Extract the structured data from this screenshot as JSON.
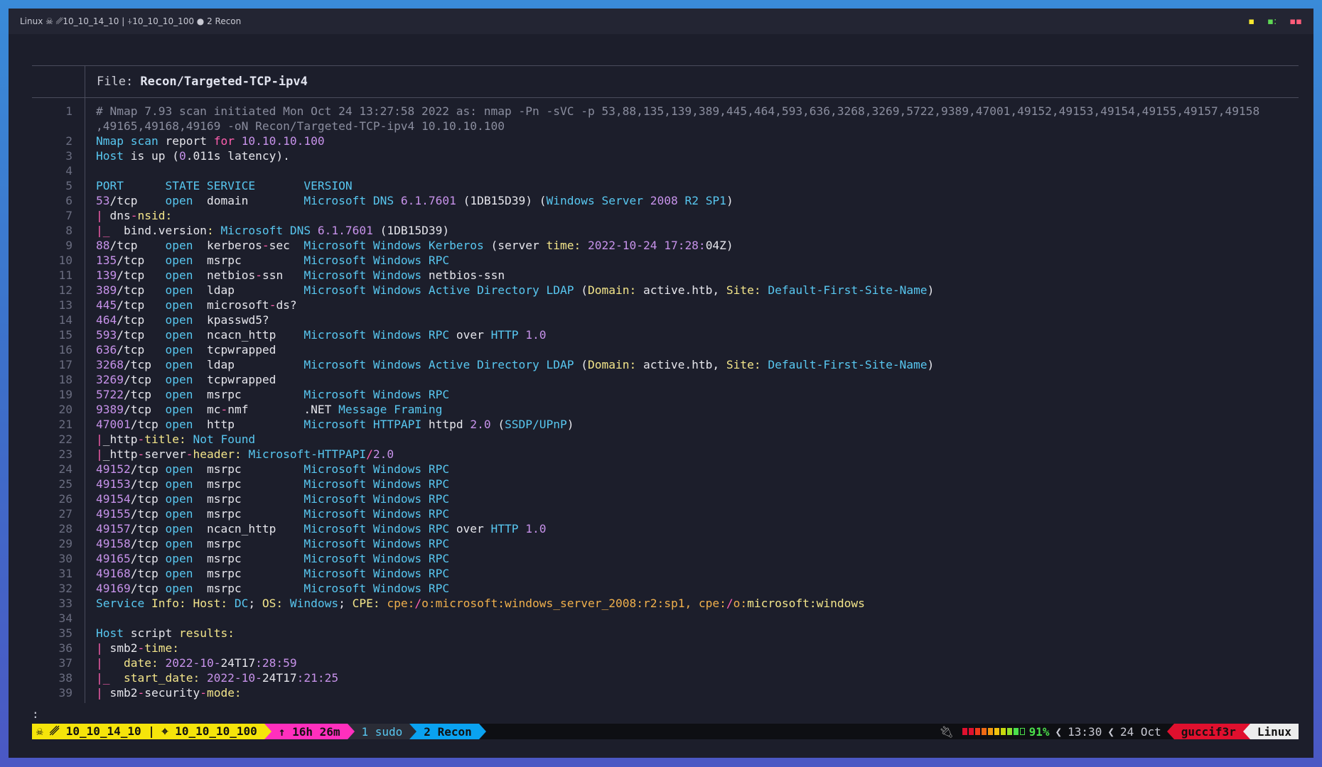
{
  "window": {
    "title": "Linux ☠ ␥10_10_14_10 | ⍭10_10_10_100 ● 2 Recon"
  },
  "pager": {
    "file_label": "File: ",
    "file_name": "Recon/Targeted-TCP-ipv4",
    "prompt": ":"
  },
  "lines": [
    {
      "n": "1",
      "segs": [
        [
          "c-cm",
          "# Nmap 7.93 scan initiated Mon Oct 24 13:27:58 2022 as: nmap -Pn -sVC -p 53,88,135,139,389,445,464,593,636,3268,3269,5722,9389,47001,49152,49153,49154,49155,49157,49158"
        ]
      ]
    },
    {
      "n": "",
      "segs": [
        [
          "c-cm",
          ",49165,49168,49169 -oN Recon/Targeted-TCP-ipv4 10.10.10.100"
        ]
      ]
    },
    {
      "n": "2",
      "segs": [
        [
          "c-cy",
          "Nmap scan "
        ],
        [
          "c-wh",
          "report "
        ],
        [
          "c-pk",
          "for "
        ],
        [
          "c-pu",
          "10.10.10.100"
        ]
      ]
    },
    {
      "n": "3",
      "segs": [
        [
          "c-cy",
          "Host "
        ],
        [
          "c-wh",
          "is up ("
        ],
        [
          "c-pu",
          "0"
        ],
        [
          "c-wh",
          ".011s latency)."
        ]
      ]
    },
    {
      "n": "4",
      "segs": [
        [
          "c-wh",
          ""
        ]
      ]
    },
    {
      "n": "5",
      "segs": [
        [
          "c-cy",
          "PORT      STATE SERVICE       VERSION"
        ]
      ]
    },
    {
      "n": "6",
      "segs": [
        [
          "c-pu",
          "53"
        ],
        [
          "c-wh",
          "/tcp    "
        ],
        [
          "c-cy",
          "open  "
        ],
        [
          "c-wh",
          "domain        "
        ],
        [
          "c-cy",
          "Microsoft DNS "
        ],
        [
          "c-pu",
          "6.1.7601 "
        ],
        [
          "c-wh",
          "(1DB15D39) ("
        ],
        [
          "c-cy",
          "Windows Server "
        ],
        [
          "c-pu",
          "2008 "
        ],
        [
          "c-cy",
          "R2 SP1"
        ],
        [
          "c-wh",
          ")"
        ]
      ]
    },
    {
      "n": "7",
      "segs": [
        [
          "c-pk",
          "| "
        ],
        [
          "c-wh",
          "dns"
        ],
        [
          "c-pk",
          "-"
        ],
        [
          "c-ye",
          "nsid:"
        ]
      ]
    },
    {
      "n": "8",
      "segs": [
        [
          "c-pk",
          "|_  "
        ],
        [
          "c-wh",
          "bind.version"
        ],
        [
          "c-ye",
          ": "
        ],
        [
          "c-cy",
          "Microsoft DNS "
        ],
        [
          "c-pu",
          "6.1.7601 "
        ],
        [
          "c-wh",
          "(1DB15D39)"
        ]
      ]
    },
    {
      "n": "9",
      "segs": [
        [
          "c-pu",
          "88"
        ],
        [
          "c-wh",
          "/tcp    "
        ],
        [
          "c-cy",
          "open  "
        ],
        [
          "c-wh",
          "kerberos"
        ],
        [
          "c-pk",
          "-"
        ],
        [
          "c-wh",
          "sec  "
        ],
        [
          "c-cy",
          "Microsoft Windows Kerberos "
        ],
        [
          "c-wh",
          "(server "
        ],
        [
          "c-ye",
          "time: "
        ],
        [
          "c-pu",
          "2022-10-24 17:28:"
        ],
        [
          "c-wh",
          "04Z)"
        ]
      ]
    },
    {
      "n": "10",
      "segs": [
        [
          "c-pu",
          "135"
        ],
        [
          "c-wh",
          "/tcp   "
        ],
        [
          "c-cy",
          "open  "
        ],
        [
          "c-wh",
          "msrpc         "
        ],
        [
          "c-cy",
          "Microsoft Windows RPC"
        ]
      ]
    },
    {
      "n": "11",
      "segs": [
        [
          "c-pu",
          "139"
        ],
        [
          "c-wh",
          "/tcp   "
        ],
        [
          "c-cy",
          "open  "
        ],
        [
          "c-wh",
          "netbios"
        ],
        [
          "c-pk",
          "-"
        ],
        [
          "c-wh",
          "ssn   "
        ],
        [
          "c-cy",
          "Microsoft Windows "
        ],
        [
          "c-wh",
          "netbios-ssn"
        ]
      ]
    },
    {
      "n": "12",
      "segs": [
        [
          "c-pu",
          "389"
        ],
        [
          "c-wh",
          "/tcp   "
        ],
        [
          "c-cy",
          "open  "
        ],
        [
          "c-wh",
          "ldap          "
        ],
        [
          "c-cy",
          "Microsoft Windows Active Directory LDAP "
        ],
        [
          "c-wh",
          "("
        ],
        [
          "c-ye",
          "Domain: "
        ],
        [
          "c-wh",
          "active.htb, "
        ],
        [
          "c-ye",
          "Site: "
        ],
        [
          "c-cy",
          "Default-First-Site-Name"
        ],
        [
          "c-wh",
          ")"
        ]
      ]
    },
    {
      "n": "13",
      "segs": [
        [
          "c-pu",
          "445"
        ],
        [
          "c-wh",
          "/tcp   "
        ],
        [
          "c-cy",
          "open  "
        ],
        [
          "c-wh",
          "microsoft"
        ],
        [
          "c-pk",
          "-"
        ],
        [
          "c-wh",
          "ds?"
        ]
      ]
    },
    {
      "n": "14",
      "segs": [
        [
          "c-pu",
          "464"
        ],
        [
          "c-wh",
          "/tcp   "
        ],
        [
          "c-cy",
          "open  "
        ],
        [
          "c-wh",
          "kpasswd5?"
        ]
      ]
    },
    {
      "n": "15",
      "segs": [
        [
          "c-pu",
          "593"
        ],
        [
          "c-wh",
          "/tcp   "
        ],
        [
          "c-cy",
          "open  "
        ],
        [
          "c-wh",
          "ncacn_http    "
        ],
        [
          "c-cy",
          "Microsoft Windows RPC "
        ],
        [
          "c-wh",
          "over "
        ],
        [
          "c-cy",
          "HTTP "
        ],
        [
          "c-pu",
          "1.0"
        ]
      ]
    },
    {
      "n": "16",
      "segs": [
        [
          "c-pu",
          "636"
        ],
        [
          "c-wh",
          "/tcp   "
        ],
        [
          "c-cy",
          "open  "
        ],
        [
          "c-wh",
          "tcpwrapped"
        ]
      ]
    },
    {
      "n": "17",
      "segs": [
        [
          "c-pu",
          "3268"
        ],
        [
          "c-wh",
          "/tcp  "
        ],
        [
          "c-cy",
          "open  "
        ],
        [
          "c-wh",
          "ldap          "
        ],
        [
          "c-cy",
          "Microsoft Windows Active Directory LDAP "
        ],
        [
          "c-wh",
          "("
        ],
        [
          "c-ye",
          "Domain: "
        ],
        [
          "c-wh",
          "active.htb, "
        ],
        [
          "c-ye",
          "Site: "
        ],
        [
          "c-cy",
          "Default-First-Site-Name"
        ],
        [
          "c-wh",
          ")"
        ]
      ]
    },
    {
      "n": "18",
      "segs": [
        [
          "c-pu",
          "3269"
        ],
        [
          "c-wh",
          "/tcp  "
        ],
        [
          "c-cy",
          "open  "
        ],
        [
          "c-wh",
          "tcpwrapped"
        ]
      ]
    },
    {
      "n": "19",
      "segs": [
        [
          "c-pu",
          "5722"
        ],
        [
          "c-wh",
          "/tcp  "
        ],
        [
          "c-cy",
          "open  "
        ],
        [
          "c-wh",
          "msrpc         "
        ],
        [
          "c-cy",
          "Microsoft Windows RPC"
        ]
      ]
    },
    {
      "n": "20",
      "segs": [
        [
          "c-pu",
          "9389"
        ],
        [
          "c-wh",
          "/tcp  "
        ],
        [
          "c-cy",
          "open  "
        ],
        [
          "c-wh",
          "mc"
        ],
        [
          "c-pk",
          "-"
        ],
        [
          "c-wh",
          "nmf        .NET "
        ],
        [
          "c-cy",
          "Message Framing"
        ]
      ]
    },
    {
      "n": "21",
      "segs": [
        [
          "c-pu",
          "47001"
        ],
        [
          "c-wh",
          "/tcp "
        ],
        [
          "c-cy",
          "open  "
        ],
        [
          "c-wh",
          "http          "
        ],
        [
          "c-cy",
          "Microsoft HTTPAPI "
        ],
        [
          "c-wh",
          "httpd "
        ],
        [
          "c-pu",
          "2.0 "
        ],
        [
          "c-wh",
          "("
        ],
        [
          "c-cy",
          "SSDP/UPnP"
        ],
        [
          "c-wh",
          ")"
        ]
      ]
    },
    {
      "n": "22",
      "segs": [
        [
          "c-pk",
          "|"
        ],
        [
          "c-wh",
          "_http"
        ],
        [
          "c-pk",
          "-"
        ],
        [
          "c-ye",
          "title: "
        ],
        [
          "c-cy",
          "Not Found"
        ]
      ]
    },
    {
      "n": "23",
      "segs": [
        [
          "c-pk",
          "|"
        ],
        [
          "c-wh",
          "_http"
        ],
        [
          "c-pk",
          "-"
        ],
        [
          "c-wh",
          "server"
        ],
        [
          "c-pk",
          "-"
        ],
        [
          "c-ye",
          "header: "
        ],
        [
          "c-cy",
          "Microsoft-HTTPAPI"
        ],
        [
          "c-pk",
          "/"
        ],
        [
          "c-pu",
          "2.0"
        ]
      ]
    },
    {
      "n": "24",
      "segs": [
        [
          "c-pu",
          "49152"
        ],
        [
          "c-wh",
          "/tcp "
        ],
        [
          "c-cy",
          "open  "
        ],
        [
          "c-wh",
          "msrpc         "
        ],
        [
          "c-cy",
          "Microsoft Windows RPC"
        ]
      ]
    },
    {
      "n": "25",
      "segs": [
        [
          "c-pu",
          "49153"
        ],
        [
          "c-wh",
          "/tcp "
        ],
        [
          "c-cy",
          "open  "
        ],
        [
          "c-wh",
          "msrpc         "
        ],
        [
          "c-cy",
          "Microsoft Windows RPC"
        ]
      ]
    },
    {
      "n": "26",
      "segs": [
        [
          "c-pu",
          "49154"
        ],
        [
          "c-wh",
          "/tcp "
        ],
        [
          "c-cy",
          "open  "
        ],
        [
          "c-wh",
          "msrpc         "
        ],
        [
          "c-cy",
          "Microsoft Windows RPC"
        ]
      ]
    },
    {
      "n": "27",
      "segs": [
        [
          "c-pu",
          "49155"
        ],
        [
          "c-wh",
          "/tcp "
        ],
        [
          "c-cy",
          "open  "
        ],
        [
          "c-wh",
          "msrpc         "
        ],
        [
          "c-cy",
          "Microsoft Windows RPC"
        ]
      ]
    },
    {
      "n": "28",
      "segs": [
        [
          "c-pu",
          "49157"
        ],
        [
          "c-wh",
          "/tcp "
        ],
        [
          "c-cy",
          "open  "
        ],
        [
          "c-wh",
          "ncacn_http    "
        ],
        [
          "c-cy",
          "Microsoft Windows RPC "
        ],
        [
          "c-wh",
          "over "
        ],
        [
          "c-cy",
          "HTTP "
        ],
        [
          "c-pu",
          "1.0"
        ]
      ]
    },
    {
      "n": "29",
      "segs": [
        [
          "c-pu",
          "49158"
        ],
        [
          "c-wh",
          "/tcp "
        ],
        [
          "c-cy",
          "open  "
        ],
        [
          "c-wh",
          "msrpc         "
        ],
        [
          "c-cy",
          "Microsoft Windows RPC"
        ]
      ]
    },
    {
      "n": "30",
      "segs": [
        [
          "c-pu",
          "49165"
        ],
        [
          "c-wh",
          "/tcp "
        ],
        [
          "c-cy",
          "open  "
        ],
        [
          "c-wh",
          "msrpc         "
        ],
        [
          "c-cy",
          "Microsoft Windows RPC"
        ]
      ]
    },
    {
      "n": "31",
      "segs": [
        [
          "c-pu",
          "49168"
        ],
        [
          "c-wh",
          "/tcp "
        ],
        [
          "c-cy",
          "open  "
        ],
        [
          "c-wh",
          "msrpc         "
        ],
        [
          "c-cy",
          "Microsoft Windows RPC"
        ]
      ]
    },
    {
      "n": "32",
      "segs": [
        [
          "c-pu",
          "49169"
        ],
        [
          "c-wh",
          "/tcp "
        ],
        [
          "c-cy",
          "open  "
        ],
        [
          "c-wh",
          "msrpc         "
        ],
        [
          "c-cy",
          "Microsoft Windows RPC"
        ]
      ]
    },
    {
      "n": "33",
      "segs": [
        [
          "c-cy",
          "Service "
        ],
        [
          "c-ye",
          "Info: Host: "
        ],
        [
          "c-cy",
          "DC"
        ],
        [
          "c-wh",
          "; "
        ],
        [
          "c-ye",
          "OS: "
        ],
        [
          "c-cy",
          "Windows"
        ],
        [
          "c-wh",
          "; "
        ],
        [
          "c-ye",
          "CPE: "
        ],
        [
          "c-or",
          "cpe:"
        ],
        [
          "c-pk",
          "/"
        ],
        [
          "c-or",
          "o:microsoft:windows_server_2008:r2:sp1, cpe:"
        ],
        [
          "c-pk",
          "/"
        ],
        [
          "c-or",
          "o:"
        ],
        [
          "c-ye",
          "microsoft:windows"
        ]
      ]
    },
    {
      "n": "34",
      "segs": [
        [
          "c-wh",
          ""
        ]
      ]
    },
    {
      "n": "35",
      "segs": [
        [
          "c-cy",
          "Host "
        ],
        [
          "c-wh",
          "script "
        ],
        [
          "c-ye",
          "results:"
        ]
      ]
    },
    {
      "n": "36",
      "segs": [
        [
          "c-pk",
          "| "
        ],
        [
          "c-wh",
          "smb2"
        ],
        [
          "c-pk",
          "-"
        ],
        [
          "c-ye",
          "time:"
        ]
      ]
    },
    {
      "n": "37",
      "segs": [
        [
          "c-pk",
          "|   "
        ],
        [
          "c-ye",
          "date: "
        ],
        [
          "c-pu",
          "2022-10-"
        ],
        [
          "c-wh",
          "24T17"
        ],
        [
          "c-pu",
          ":28:59"
        ]
      ]
    },
    {
      "n": "38",
      "segs": [
        [
          "c-pk",
          "|_  "
        ],
        [
          "c-ye",
          "start_date: "
        ],
        [
          "c-pu",
          "2022-10-"
        ],
        [
          "c-wh",
          "24T17"
        ],
        [
          "c-pu",
          ":21:25"
        ]
      ]
    },
    {
      "n": "39",
      "segs": [
        [
          "c-pk",
          "| "
        ],
        [
          "c-wh",
          "smb2"
        ],
        [
          "c-pk",
          "-"
        ],
        [
          "c-wh",
          "security"
        ],
        [
          "c-pk",
          "-"
        ],
        [
          "c-ye",
          "mode:"
        ]
      ]
    }
  ],
  "statusbar": {
    "host": "☠ ␥ 10_10_14_10 | ⌖ 10_10_10_100",
    "uptime": "↑ 16h 26m",
    "window1": "1 sudo",
    "window2": "2 Recon",
    "battery_percent": "91%",
    "battery_level": 0.91,
    "time": "13:30",
    "date": "24 Oct",
    "user": "guccif3r",
    "os": "Linux"
  },
  "colors": {
    "host_bg": "#f5e40a",
    "uptime_bg": "#ff2fbd",
    "recon_bg": "#0aa2f0",
    "user_bg": "#e0102e",
    "accent_cyan": "#58c7f0",
    "accent_purple": "#c792ea"
  }
}
